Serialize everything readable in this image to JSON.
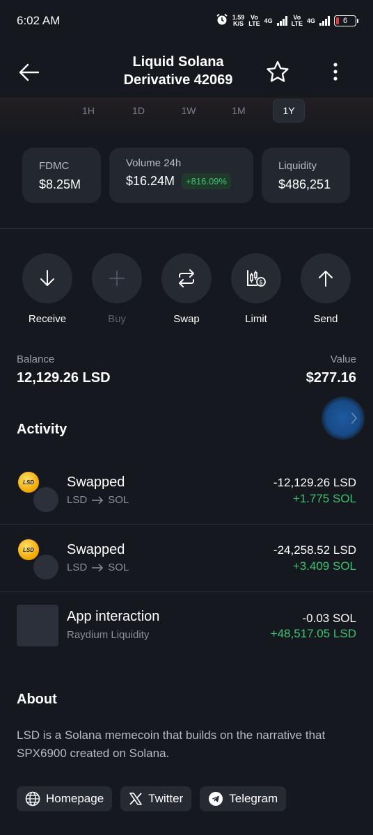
{
  "status_bar": {
    "time": "6:02 AM",
    "speed_value": "1.59",
    "speed_unit": "K/S",
    "sim1_top": "Vo",
    "sim1_bottom": "LTE",
    "net1": "4G",
    "sim2_top": "Vo",
    "sim2_bottom": "LTE",
    "net2": "4G",
    "battery": "6",
    "battery_color": "#e53935"
  },
  "header": {
    "title_line1": "Liquid Solana",
    "title_line2": "Derivative 42069",
    "back_icon": "arrow-left-icon",
    "favorite_icon": "star-icon",
    "more_icon": "more-vertical-icon"
  },
  "timeframes": [
    "1H",
    "1D",
    "1W",
    "1M",
    "1Y"
  ],
  "selected_timeframe": "1Y",
  "stats": {
    "fdmc": {
      "label": "FDMC",
      "value": "$8.25M"
    },
    "volume": {
      "label": "Volume 24h",
      "value": "$16.24M",
      "change": "+816.09%"
    },
    "liquidity": {
      "label": "Liquidity",
      "value": "$486,251"
    }
  },
  "actions": [
    {
      "label": "Receive",
      "icon": "arrow-down-icon",
      "enabled": true
    },
    {
      "label": "Buy",
      "icon": "plus-icon",
      "enabled": false
    },
    {
      "label": "Swap",
      "icon": "swap-icon",
      "enabled": true
    },
    {
      "label": "Limit",
      "icon": "limit-chart-icon",
      "enabled": true
    },
    {
      "label": "Send",
      "icon": "arrow-up-icon",
      "enabled": true
    }
  ],
  "balance": {
    "balance_label": "Balance",
    "balance_value": "12,129.26 LSD",
    "value_label": "Value",
    "value_amount": "$277.16"
  },
  "activity": {
    "title": "Activity",
    "items": [
      {
        "title": "Swapped",
        "from": "LSD",
        "to": "SOL",
        "amount_out": "-12,129.26 LSD",
        "amount_in": "+1.775 SOL"
      },
      {
        "title": "Swapped",
        "from": "LSD",
        "to": "SOL",
        "amount_out": "-24,258.52 LSD",
        "amount_in": "+3.409 SOL"
      },
      {
        "title": "App interaction",
        "subtitle": "Raydium Liquidity",
        "amount_out": "-0.03 SOL",
        "amount_in": "+48,517.05 LSD"
      }
    ]
  },
  "about": {
    "title": "About",
    "text": "LSD is a Solana memecoin that builds on the narrative that SPX6900 created on Solana."
  },
  "links": [
    {
      "label": "Homepage",
      "icon": "globe-icon"
    },
    {
      "label": "Twitter",
      "icon": "x-logo-icon"
    },
    {
      "label": "Telegram",
      "icon": "telegram-icon"
    }
  ],
  "colors": {
    "background": "#15181f",
    "card": "#232730",
    "positive": "#3fc373",
    "accent_fab": "#1e5aa0"
  }
}
